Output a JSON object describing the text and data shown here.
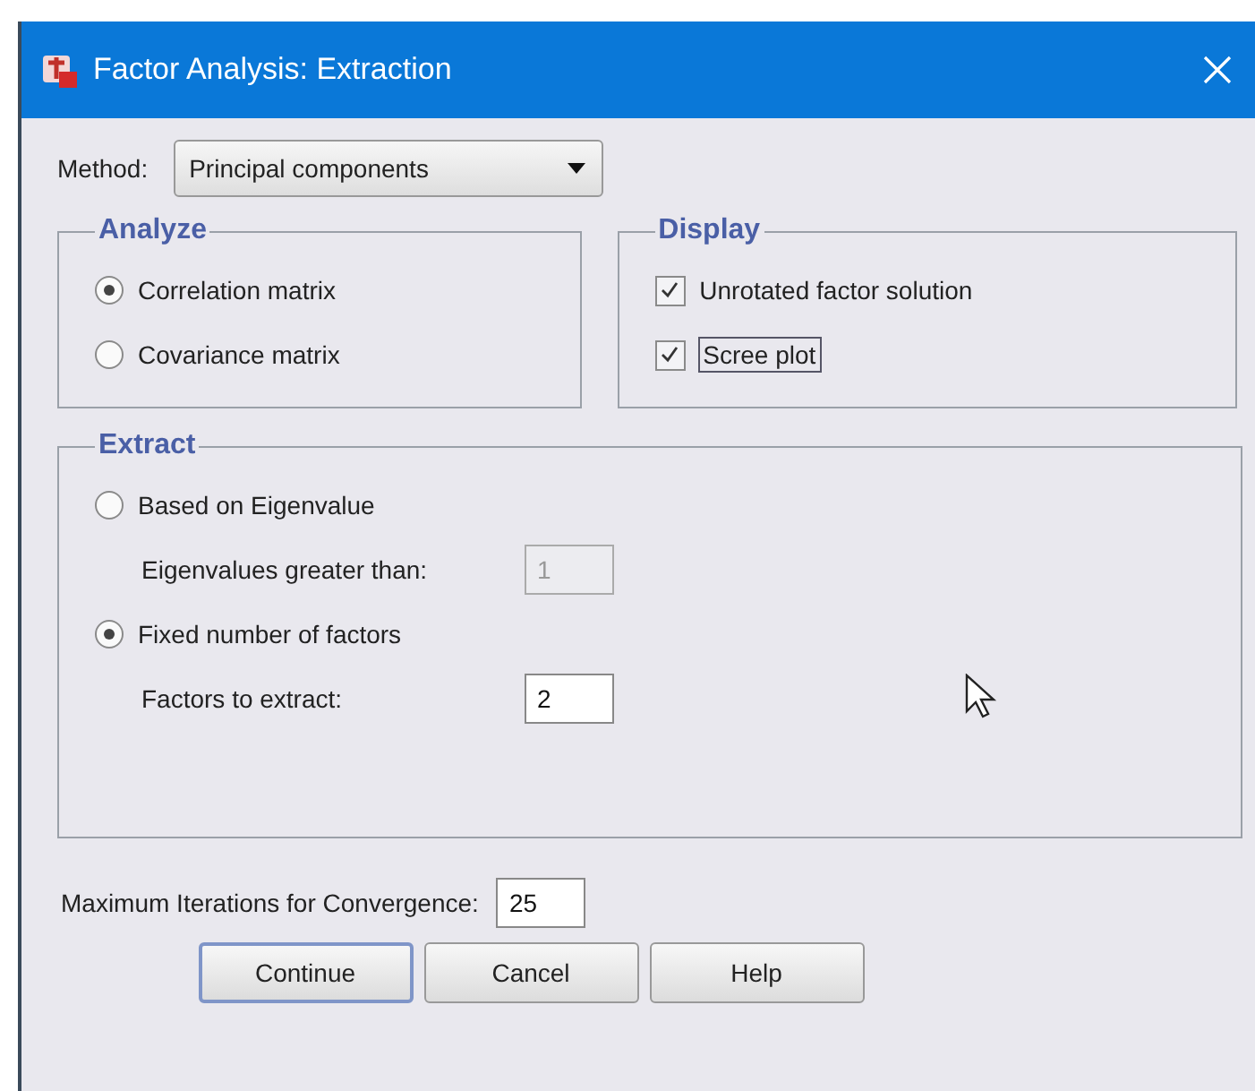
{
  "window": {
    "title": "Factor Analysis: Extraction"
  },
  "method": {
    "label": "Method:",
    "value": "Principal components"
  },
  "analyze": {
    "title": "Analyze",
    "options": [
      {
        "label": "Correlation matrix",
        "selected": true
      },
      {
        "label": "Covariance matrix",
        "selected": false
      }
    ]
  },
  "display": {
    "title": "Display",
    "options": [
      {
        "label": "Unrotated factor solution",
        "checked": true,
        "focused": false
      },
      {
        "label": "Scree plot",
        "checked": true,
        "focused": true
      }
    ]
  },
  "extract": {
    "title": "Extract",
    "options": [
      {
        "label": "Based on Eigenvalue",
        "selected": false,
        "field": {
          "label": "Eigenvalues greater than:",
          "value": "1",
          "disabled": true
        }
      },
      {
        "label": "Fixed number of factors",
        "selected": true,
        "field": {
          "label": "Factors to extract:",
          "value": "2",
          "disabled": false
        }
      }
    ]
  },
  "iterations": {
    "label": "Maximum Iterations for Convergence:",
    "value": "25"
  },
  "buttons": [
    {
      "label": "Continue",
      "default": true
    },
    {
      "label": "Cancel",
      "default": false
    },
    {
      "label": "Help",
      "default": false
    }
  ]
}
